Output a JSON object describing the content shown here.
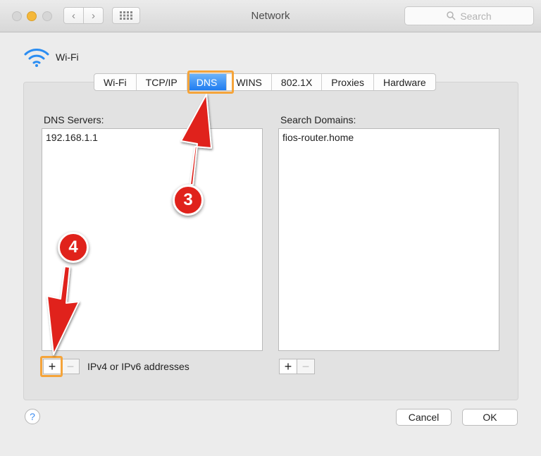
{
  "window": {
    "title": "Network"
  },
  "toolbar": {
    "back_glyph": "‹",
    "forward_glyph": "›",
    "grid_glyph": "⋮⋮⋮",
    "search_placeholder": "Search",
    "search_icon": "magnifier-icon"
  },
  "header": {
    "interface_name": "Wi-Fi",
    "icon": "wifi-icon"
  },
  "tabs": [
    {
      "label": "Wi-Fi",
      "active": false
    },
    {
      "label": "TCP/IP",
      "active": false
    },
    {
      "label": "DNS",
      "active": true
    },
    {
      "label": "WINS",
      "active": false
    },
    {
      "label": "802.1X",
      "active": false
    },
    {
      "label": "Proxies",
      "active": false
    },
    {
      "label": "Hardware",
      "active": false
    }
  ],
  "dns": {
    "label": "DNS Servers:",
    "servers": [
      "192.168.1.1"
    ],
    "add": "+",
    "remove": "−",
    "hint": "IPv4 or IPv6 addresses"
  },
  "search_domains": {
    "label": "Search Domains:",
    "domains": [
      "fios-router.home"
    ],
    "add": "+",
    "remove": "−"
  },
  "footer": {
    "help": "?",
    "cancel": "Cancel",
    "ok": "OK"
  },
  "annotations": [
    {
      "number": "3"
    },
    {
      "number": "4"
    }
  ],
  "colors": {
    "accent": "#1f7cf0",
    "highlight": "#f5a43a",
    "badge": "#e0221b",
    "arrow": "#e0221b"
  }
}
